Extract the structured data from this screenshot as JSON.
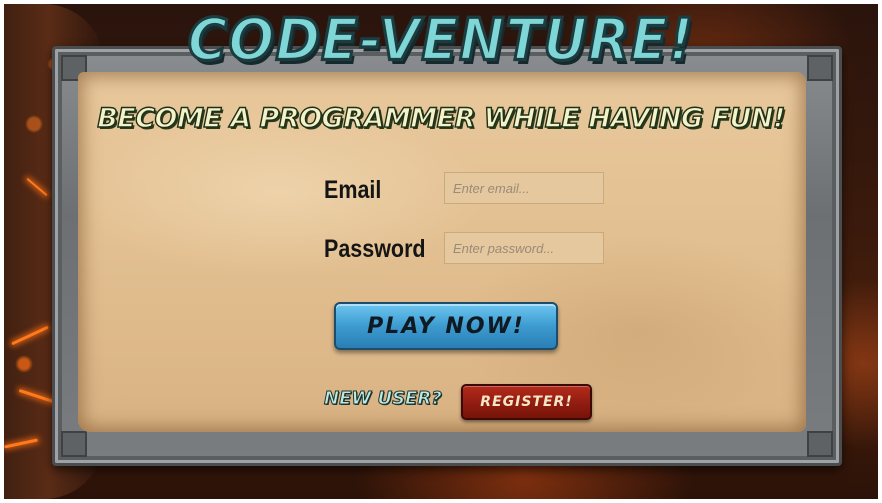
{
  "game": {
    "title": "CODE-VENTURE!",
    "tagline": "BECOME A PROGRAMMER WHILE HAVING FUN!"
  },
  "login_form": {
    "email_label": "Email",
    "email_placeholder": "Enter email...",
    "email_value": "",
    "password_label": "Password",
    "password_placeholder": "Enter password...",
    "password_value": "",
    "play_button_label": "PLAY NOW!",
    "new_user_text": "NEW USER?",
    "register_button_label": "REGISTER!"
  },
  "colors": {
    "title": "#7fd6d6",
    "play_button": "#3d9bd0",
    "register_button": "#8e1b10",
    "parchment": "#e2bf90"
  }
}
